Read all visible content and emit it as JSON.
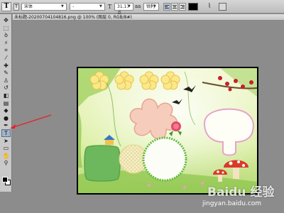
{
  "options_bar": {
    "tool_preset_icon": "T",
    "orientation_icon": "T",
    "font_family": "宋体",
    "font_style": "-",
    "font_size": "31.17 点",
    "antialias_label": "aa",
    "antialias": "锐利",
    "text_color": "#000000",
    "warp_icon": "warp-text-icon",
    "warp_glyph": "⌇",
    "panels_icon": "character-panel-icon"
  },
  "document": {
    "tab_title": "未标题-20200704104816.png @ 100% (图层 0, RGB/8#)"
  },
  "toolbox": {
    "tools": [
      {
        "name": "move-tool-icon",
        "glyph": "✥"
      },
      {
        "name": "marquee-tool-icon",
        "glyph": "⬚"
      },
      {
        "name": "lasso-tool-icon",
        "glyph": "ꝺ"
      },
      {
        "name": "magic-wand-tool-icon",
        "glyph": "⚡"
      },
      {
        "name": "crop-tool-icon",
        "glyph": "⌗"
      },
      {
        "name": "eyedropper-tool-icon",
        "glyph": "⁄"
      },
      {
        "name": "healing-brush-tool-icon",
        "glyph": "✚"
      },
      {
        "name": "brush-tool-icon",
        "glyph": "✎"
      },
      {
        "name": "clone-stamp-tool-icon",
        "glyph": "♙"
      },
      {
        "name": "history-brush-tool-icon",
        "glyph": "↺"
      },
      {
        "name": "eraser-tool-icon",
        "glyph": "◧"
      },
      {
        "name": "gradient-tool-icon",
        "glyph": "▤"
      },
      {
        "name": "blur-tool-icon",
        "glyph": "◆"
      },
      {
        "name": "dodge-tool-icon",
        "glyph": "●"
      },
      {
        "name": "pen-tool-icon",
        "glyph": "✒"
      },
      {
        "name": "type-tool-icon",
        "glyph": "T"
      },
      {
        "name": "path-selection-tool-icon",
        "glyph": "➤"
      },
      {
        "name": "shape-tool-icon",
        "glyph": "▭"
      },
      {
        "name": "hand-tool-icon",
        "glyph": "✋"
      },
      {
        "name": "zoom-tool-icon",
        "glyph": "⚲"
      }
    ],
    "active_tool": "type-tool-icon",
    "foreground_color": "#000000",
    "background_color": "#ffffff"
  },
  "annotation": {
    "arrow_color": "#e8202a"
  },
  "watermark": {
    "logo": "Baidu 经验",
    "url": "jingyan.baidu.com"
  }
}
